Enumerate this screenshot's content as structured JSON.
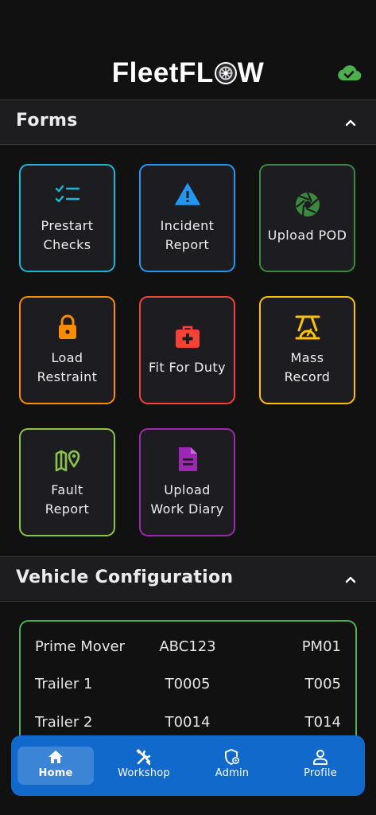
{
  "app": {
    "logo_left": "FleetFL",
    "logo_right": "W",
    "sync_icon": "cloud-check-icon",
    "colors": {
      "sync": "#4caf50",
      "nav": "#1269cc"
    }
  },
  "forms": {
    "title": "Forms",
    "tiles": [
      {
        "label": "Prestart\nChecks",
        "icon": "checklist-icon",
        "color": "#1ab8d6"
      },
      {
        "label": "Incident\nReport",
        "icon": "warning-icon",
        "color": "#2196f3"
      },
      {
        "label": "Upload POD",
        "icon": "camera-aperture-icon",
        "color": "#3a8a3e"
      },
      {
        "label": "Load\nRestraint",
        "icon": "lock-icon",
        "color": "#fb8c00"
      },
      {
        "label": "Fit For Duty",
        "icon": "first-aid-kit-icon",
        "color": "#f44336"
      },
      {
        "label": "Mass\nRecord",
        "icon": "scale-icon",
        "color": "#ffc107"
      },
      {
        "label": "Fault\nReport",
        "icon": "map-pin-route-icon",
        "color": "#8bc34a"
      },
      {
        "label": "Upload\nWork Diary",
        "icon": "document-icon",
        "color": "#9c27b0"
      }
    ]
  },
  "vehicle_config": {
    "title": "Vehicle Configuration",
    "rows": [
      {
        "type": "Prime Mover",
        "rego": "ABC123",
        "code": "PM01"
      },
      {
        "type": "Trailer 1",
        "rego": "T0005",
        "code": "T005"
      },
      {
        "type": "Trailer 2",
        "rego": "T0014",
        "code": "T014"
      }
    ]
  },
  "nav": {
    "items": [
      {
        "label": "Home",
        "icon": "home-icon",
        "active": true
      },
      {
        "label": "Workshop",
        "icon": "tools-icon",
        "active": false
      },
      {
        "label": "Admin",
        "icon": "shield-gear-icon",
        "active": false
      },
      {
        "label": "Profile",
        "icon": "person-icon",
        "active": false
      }
    ]
  }
}
